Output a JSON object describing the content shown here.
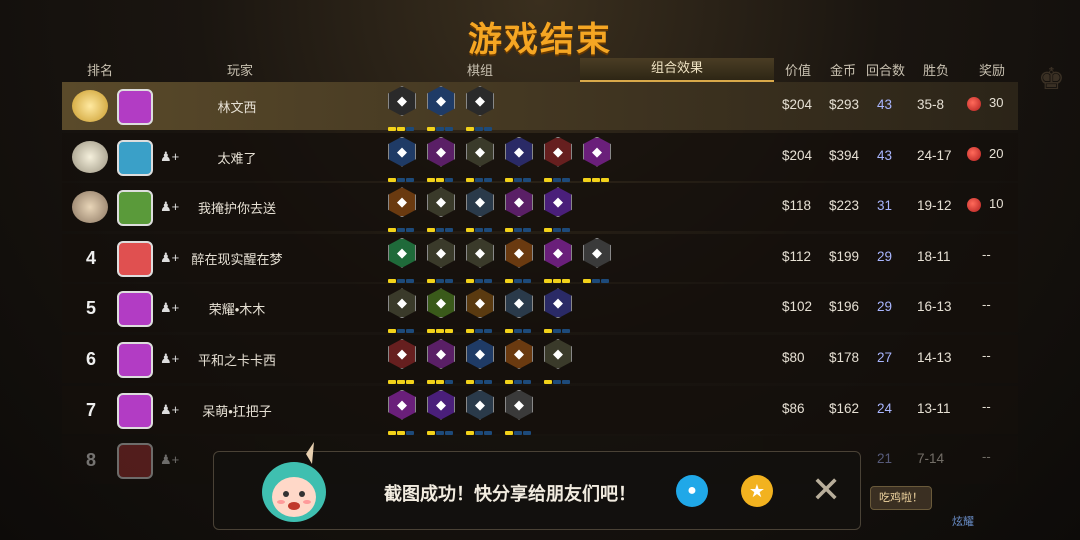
{
  "title": "游戏结束",
  "headers": {
    "rank": "排名",
    "player": "玩家",
    "pieces": "棋组",
    "synergy": "组合效果",
    "value": "价值",
    "gold": "金币",
    "rounds": "回合数",
    "record": "胜负",
    "reward": "奖励"
  },
  "rows": [
    {
      "rank": "",
      "name": "林文西",
      "value": "$204",
      "gold": "$293",
      "rounds": "43",
      "record": "35-8",
      "reward": "30",
      "medal": "gold",
      "avatar_color": "#b23cc4",
      "traits": [
        {
          "icon": "lion-icon",
          "color": "#2a2a2a",
          "pips": [
            1,
            1,
            0
          ]
        },
        {
          "icon": "question-icon",
          "color": "#1f3b66",
          "pips": [
            1,
            0,
            0
          ]
        },
        {
          "icon": "knight-icon",
          "color": "#2a2a2a",
          "pips": [
            1,
            0,
            0
          ]
        }
      ]
    },
    {
      "rank": "",
      "name": "太难了",
      "value": "$204",
      "gold": "$394",
      "rounds": "43",
      "record": "24-17",
      "reward": "20",
      "medal": "silver",
      "avatar_color": "#3aa0c8",
      "traits": [
        {
          "icon": "question-icon",
          "color": "#1f3b66",
          "pips": [
            1,
            0,
            0
          ]
        },
        {
          "icon": "chess-knight-icon",
          "color": "#5a1f66",
          "pips": [
            1,
            1,
            0
          ]
        },
        {
          "icon": "beast-icon",
          "color": "#3a3a2a",
          "pips": [
            1,
            0,
            0
          ]
        },
        {
          "icon": "mech-icon",
          "color": "#2a2a66",
          "pips": [
            1,
            0,
            0
          ]
        },
        {
          "icon": "demon-icon",
          "color": "#661f1f",
          "pips": [
            1,
            0,
            0
          ]
        },
        {
          "icon": "skull-icon",
          "color": "#6a1f7a",
          "pips": [
            1,
            1,
            1
          ]
        }
      ]
    },
    {
      "rank": "",
      "name": "我掩护你去送",
      "value": "$118",
      "gold": "$223",
      "rounds": "31",
      "record": "19-12",
      "reward": "10",
      "medal": "bronze",
      "avatar_color": "#5a9a3a",
      "traits": [
        {
          "icon": "feather-icon",
          "color": "#6a3a10",
          "pips": [
            1,
            0,
            0
          ]
        },
        {
          "icon": "swords-icon",
          "color": "#3a3a2a",
          "pips": [
            1,
            0,
            0
          ]
        },
        {
          "icon": "paws-icon",
          "color": "#2a3a4a",
          "pips": [
            1,
            0,
            0
          ]
        },
        {
          "icon": "chess-knight-icon",
          "color": "#5a1f66",
          "pips": [
            1,
            0,
            0
          ]
        },
        {
          "icon": "spirit-icon",
          "color": "#4a1f7a",
          "pips": [
            1,
            0,
            0
          ]
        }
      ]
    },
    {
      "rank": "4",
      "name": "醉在现实醒在梦",
      "value": "$112",
      "gold": "$199",
      "rounds": "29",
      "record": "18-11",
      "reward": "--",
      "medal": "",
      "avatar_color": "#e05050",
      "traits": [
        {
          "icon": "paw-icon",
          "color": "#1f6a3a",
          "pips": [
            1,
            0,
            0
          ]
        },
        {
          "icon": "axe-icon",
          "color": "#3a3a2a",
          "pips": [
            1,
            0,
            0
          ]
        },
        {
          "icon": "beast-icon",
          "color": "#3a3a2a",
          "pips": [
            1,
            0,
            0
          ]
        },
        {
          "icon": "feather-icon",
          "color": "#6a3a10",
          "pips": [
            1,
            0,
            0
          ]
        },
        {
          "icon": "skull-icon",
          "color": "#6a1f7a",
          "pips": [
            1,
            1,
            1
          ]
        },
        {
          "icon": "helmet-icon",
          "color": "#3a3a3a",
          "pips": [
            1,
            0,
            0
          ]
        }
      ]
    },
    {
      "rank": "5",
      "name": "荣耀•木木",
      "value": "$102",
      "gold": "$196",
      "rounds": "29",
      "record": "16-13",
      "reward": "--",
      "medal": "",
      "avatar_color": "#b23cc4",
      "traits": [
        {
          "icon": "swords-icon",
          "color": "#3a3a2a",
          "pips": [
            1,
            0,
            0
          ]
        },
        {
          "icon": "orbs-icon",
          "color": "#3a5a1a",
          "pips": [
            1,
            1,
            1
          ]
        },
        {
          "icon": "gear-icon",
          "color": "#5a3a10",
          "pips": [
            1,
            0,
            0
          ]
        },
        {
          "icon": "paws-icon",
          "color": "#2a3a4a",
          "pips": [
            1,
            0,
            0
          ]
        },
        {
          "icon": "fish-icon",
          "color": "#2a2a66",
          "pips": [
            1,
            0,
            0
          ]
        }
      ]
    },
    {
      "rank": "6",
      "name": "平和之卡卡西",
      "value": "$80",
      "gold": "$178",
      "rounds": "27",
      "record": "14-13",
      "reward": "--",
      "medal": "",
      "avatar_color": "#b23cc4",
      "traits": [
        {
          "icon": "arch-icon",
          "color": "#661f1f",
          "pips": [
            1,
            1,
            1
          ]
        },
        {
          "icon": "chess-knight-icon",
          "color": "#5a1f66",
          "pips": [
            1,
            1,
            0
          ]
        },
        {
          "icon": "leaf-icon",
          "color": "#1f3b66",
          "pips": [
            1,
            0,
            0
          ]
        },
        {
          "icon": "feather-icon",
          "color": "#6a3a10",
          "pips": [
            1,
            0,
            0
          ]
        },
        {
          "icon": "beast-icon",
          "color": "#3a3a2a",
          "pips": [
            1,
            0,
            0
          ]
        }
      ]
    },
    {
      "rank": "7",
      "name": "呆萌•扛把子",
      "value": "$86",
      "gold": "$162",
      "rounds": "24",
      "record": "13-11",
      "reward": "--",
      "medal": "",
      "avatar_color": "#b23cc4",
      "traits": [
        {
          "icon": "skull-icon",
          "color": "#6a1f7a",
          "pips": [
            1,
            1,
            0
          ]
        },
        {
          "icon": "spirit-icon",
          "color": "#4a1f7a",
          "pips": [
            1,
            0,
            0
          ]
        },
        {
          "icon": "paws-icon",
          "color": "#2a3a4a",
          "pips": [
            1,
            0,
            0
          ]
        },
        {
          "icon": "helmet-icon",
          "color": "#3a3a3a",
          "pips": [
            1,
            0,
            0
          ]
        }
      ]
    },
    {
      "rank": "8",
      "name": "",
      "value": "",
      "gold": "",
      "rounds": "21",
      "record": "7-14",
      "reward": "--",
      "medal": "",
      "avatar_color": "#a03030",
      "traits": []
    }
  ],
  "toast": {
    "text": "截图成功！快分享给朋友们吧！"
  },
  "side": {
    "bubble": "吃鸡啦！",
    "label": "炫耀"
  }
}
